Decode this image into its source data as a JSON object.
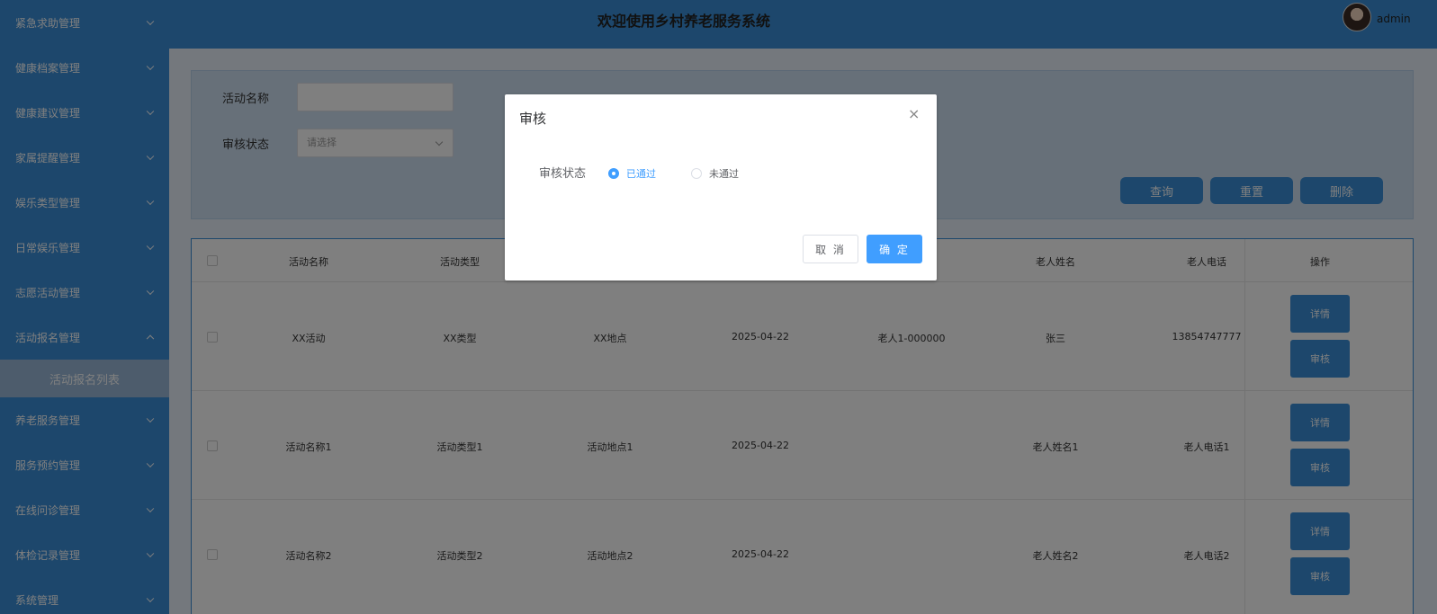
{
  "sidebar": {
    "items": [
      {
        "label": "紧急求助管理",
        "expanded": false
      },
      {
        "label": "健康档案管理",
        "expanded": false
      },
      {
        "label": "健康建议管理",
        "expanded": false
      },
      {
        "label": "家属提醒管理",
        "expanded": false
      },
      {
        "label": "娱乐类型管理",
        "expanded": false
      },
      {
        "label": "日常娱乐管理",
        "expanded": false
      },
      {
        "label": "志愿活动管理",
        "expanded": false
      },
      {
        "label": "活动报名管理",
        "expanded": true
      },
      {
        "label": "养老服务管理",
        "expanded": false
      },
      {
        "label": "服务预约管理",
        "expanded": false
      },
      {
        "label": "在线问诊管理",
        "expanded": false
      },
      {
        "label": "体检记录管理",
        "expanded": false
      },
      {
        "label": "系统管理",
        "expanded": false
      }
    ],
    "submenu_label": "活动报名列表"
  },
  "header": {
    "title": "欢迎使用乡村养老服务系统",
    "username": "admin"
  },
  "search": {
    "name_label": "活动名称",
    "name_value": "",
    "status_label": "审核状态",
    "status_placeholder": "请选择",
    "query_label": "查询",
    "reset_label": "重置",
    "delete_label": "删除"
  },
  "table": {
    "columns": [
      "活动名称",
      "活动类型",
      "",
      "",
      "",
      "老人姓名",
      "老人电话",
      "操作"
    ],
    "rows": [
      [
        "XX活动",
        "XX类型",
        "XX地点",
        "2025-04-22",
        "老人1-000000",
        "张三",
        "13854747777"
      ],
      [
        "活动名称1",
        "活动类型1",
        "活动地点1",
        "2025-04-22",
        "",
        "老人姓名1",
        "老人电话1"
      ],
      [
        "活动名称2",
        "活动类型2",
        "活动地点2",
        "2025-04-22",
        "",
        "老人姓名2",
        "老人电话2"
      ]
    ],
    "detail_label": "详情",
    "audit_label": "审核"
  },
  "dialog": {
    "title": "审核",
    "close_glyph": "×",
    "field_label": "审核状态",
    "options": [
      "已通过",
      "未通过"
    ],
    "selected": "已通过",
    "cancel_label": "取 消",
    "ok_label": "确 定"
  },
  "colors": {
    "primary": "#3a8fd8",
    "dialog_accent": "#409eff"
  }
}
